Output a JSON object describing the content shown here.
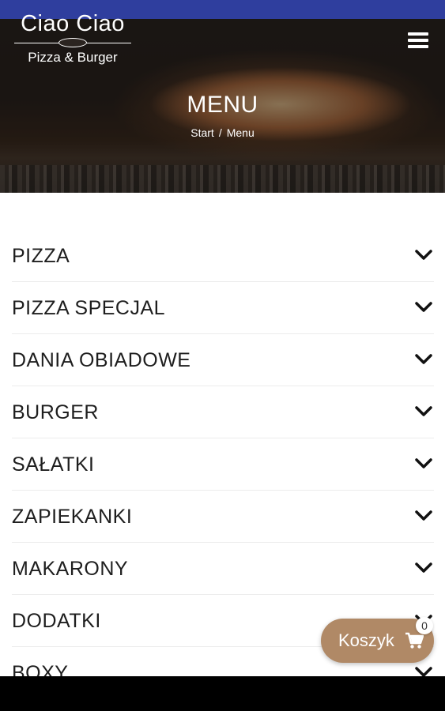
{
  "header": {
    "logo_title": "Ciao Ciao",
    "logo_subtitle": "Pizza & Burger",
    "page_title": "MENU",
    "breadcrumb": {
      "home": "Start",
      "separator": "/",
      "current": "Menu"
    }
  },
  "categories": [
    {
      "label": "PIZZA"
    },
    {
      "label": "PIZZA SPECJAL"
    },
    {
      "label": "DANIA OBIADOWE"
    },
    {
      "label": "BURGER"
    },
    {
      "label": "SAŁATKI"
    },
    {
      "label": "ZAPIEKANKI"
    },
    {
      "label": "MAKARONY"
    },
    {
      "label": "DODATKI"
    },
    {
      "label": "BOXY"
    }
  ],
  "cart": {
    "label": "Koszyk",
    "count": "0"
  },
  "colors": {
    "status_bar": "#2f3e9e",
    "cart_button": "#b08966",
    "nav_bar": "#000000"
  },
  "icons": {
    "menu": "hamburger-menu-icon",
    "expand": "chevron-down-icon",
    "cart": "shopping-cart-icon"
  }
}
